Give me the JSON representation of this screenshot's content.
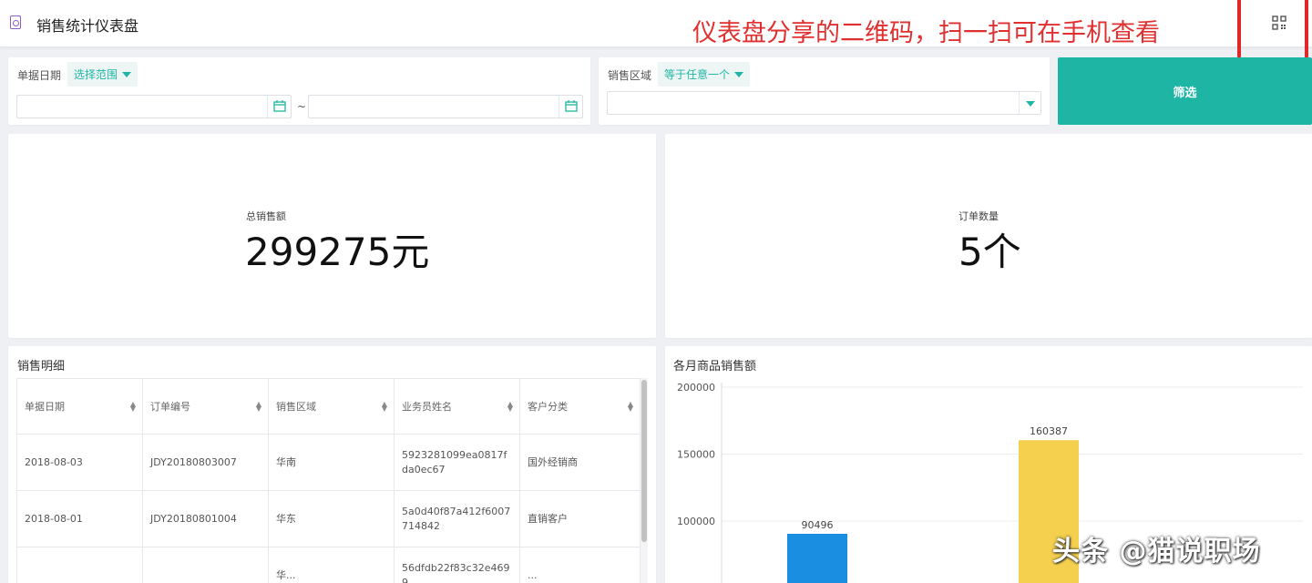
{
  "header": {
    "title": "销售统计仪表盘",
    "annotation": "仪表盘分享的二维码，扫一扫可在手机查看"
  },
  "filters": {
    "date": {
      "label": "单据日期",
      "mode": "选择范围",
      "range_separator": "~",
      "start_value": "",
      "end_value": ""
    },
    "region": {
      "label": "销售区域",
      "mode": "等于任意一个",
      "value": ""
    },
    "submit_label": "筛选"
  },
  "kpis": {
    "total_sales": {
      "label": "总销售额",
      "value": "299275元"
    },
    "order_count": {
      "label": "订单数量",
      "value": "5个"
    }
  },
  "table": {
    "title": "销售明细",
    "columns": [
      "单据日期",
      "订单编号",
      "销售区域",
      "业务员姓名",
      "客户分类"
    ],
    "rows": [
      [
        "2018-08-03",
        "JDY20180803007",
        "华南",
        "5923281099ea0817fda0ec67",
        "国外经销商"
      ],
      [
        "2018-08-01",
        "JDY20180801004",
        "华东",
        "5a0d40f87a412f6007714842",
        "直销客户"
      ],
      [
        "",
        "",
        "华...",
        "56dfdb22f83c32e4699",
        "..."
      ]
    ]
  },
  "chart_data": {
    "type": "bar",
    "title": "各月商品销售额",
    "xlabel": "",
    "ylabel": "",
    "ylim": [
      0,
      200000
    ],
    "yticks": [
      "200000",
      "150000",
      "100000"
    ],
    "grid": true,
    "series": [
      {
        "values": [
          90496,
          160387
        ],
        "colors": [
          "#1a8ee0",
          "#f5d04e"
        ]
      }
    ],
    "data_labels": [
      "90496",
      "160387"
    ]
  },
  "watermark": "头条 @猫说职场",
  "colors": {
    "accent": "#1fb5a5",
    "annotation": "#e03030"
  }
}
